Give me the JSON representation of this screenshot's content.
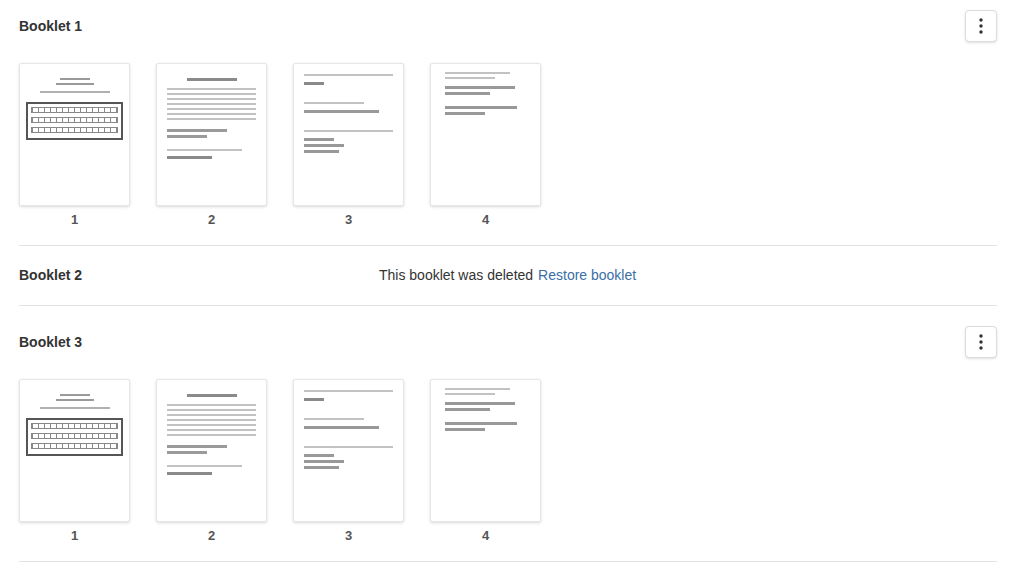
{
  "booklets": [
    {
      "title": "Booklet 1",
      "deleted": false,
      "pages": [
        {
          "number": "1",
          "kind": "cover"
        },
        {
          "number": "2",
          "kind": "typed"
        },
        {
          "number": "3",
          "kind": "questions"
        },
        {
          "number": "4",
          "kind": "notes"
        }
      ]
    },
    {
      "title": "Booklet 2",
      "deleted": true,
      "message": "This booklet was deleted",
      "restore": "Restore booklet"
    },
    {
      "title": "Booklet 3",
      "deleted": false,
      "pages": [
        {
          "number": "1",
          "kind": "cover"
        },
        {
          "number": "2",
          "kind": "typed"
        },
        {
          "number": "3",
          "kind": "questions"
        },
        {
          "number": "4",
          "kind": "notes"
        }
      ]
    }
  ]
}
